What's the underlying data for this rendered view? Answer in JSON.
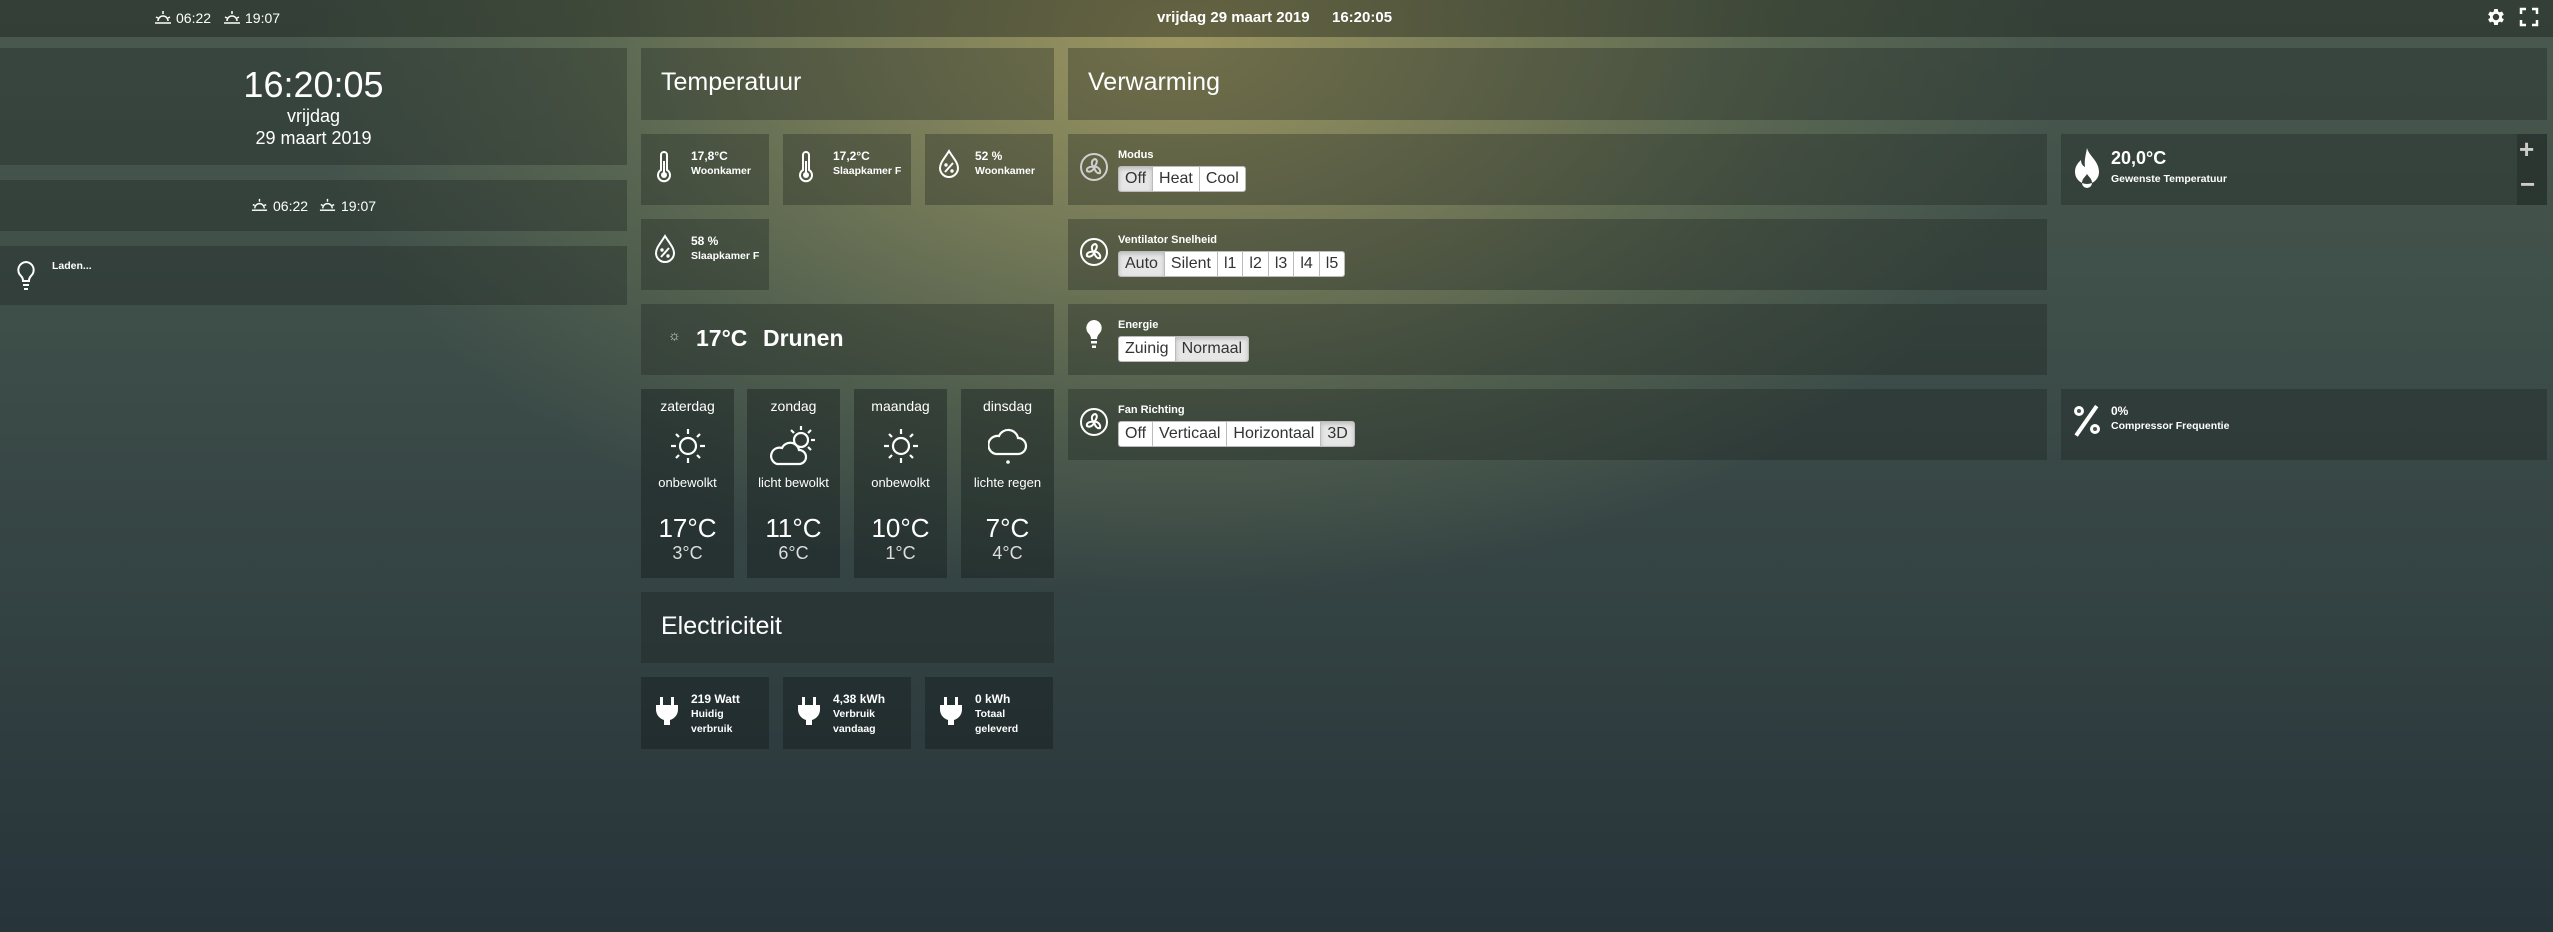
{
  "topbar": {
    "sunrise": "06:22",
    "sunset": "19:07",
    "date": "vrijdag 29 maart 2019",
    "time": "16:20:05"
  },
  "clock": {
    "time": "16:20:05",
    "weekday": "vrijdag",
    "date": "29 maart 2019"
  },
  "sun": {
    "sunrise": "06:22",
    "sunset": "19:07"
  },
  "loading": {
    "label": "Laden..."
  },
  "temperature": {
    "title": "Temperatuur",
    "tiles": [
      {
        "value": "17,8°C",
        "label": "Woonkamer"
      },
      {
        "value": "17,2°C",
        "label": "Slaapkamer F"
      },
      {
        "value": "52 %",
        "label": "Woonkamer"
      },
      {
        "value": "58 %",
        "label": "Slaapkamer F"
      }
    ]
  },
  "weather": {
    "current_temp": "17°C",
    "location": "Drunen",
    "forecast": [
      {
        "day": "zaterdag",
        "desc": "onbewolkt",
        "high": "17°C",
        "low": "3°C",
        "icon": "sun-icon"
      },
      {
        "day": "zondag",
        "desc": "licht bewolkt",
        "high": "11°C",
        "low": "6°C",
        "icon": "partly-cloudy-icon"
      },
      {
        "day": "maandag",
        "desc": "onbewolkt",
        "high": "10°C",
        "low": "1°C",
        "icon": "sun-icon"
      },
      {
        "day": "dinsdag",
        "desc": "lichte regen",
        "high": "7°C",
        "low": "4°C",
        "icon": "rain-icon"
      }
    ]
  },
  "electricity": {
    "title": "Electriciteit",
    "tiles": [
      {
        "value": "219 Watt",
        "label": "Huidig verbruik"
      },
      {
        "value": "4,38 kWh",
        "label": "Verbruik vandaag"
      },
      {
        "value": "0 kWh",
        "label": "Totaal geleverd"
      }
    ]
  },
  "heating": {
    "title": "Verwarming",
    "modus": {
      "label": "Modus",
      "options": [
        "Off",
        "Heat",
        "Cool"
      ],
      "active": "Off"
    },
    "fan_speed": {
      "label": "Ventilator Snelheid",
      "options": [
        "Auto",
        "Silent",
        "l1",
        "l2",
        "l3",
        "l4",
        "l5"
      ],
      "active": "Auto"
    },
    "energy": {
      "label": "Energie",
      "options": [
        "Zuinig",
        "Normaal"
      ],
      "active": "Normaal"
    },
    "fan_direction": {
      "label": "Fan Richting",
      "options": [
        "Off",
        "Verticaal",
        "Horizontaal",
        "3D"
      ],
      "active": "3D"
    },
    "setpoint": {
      "value": "20,0°C",
      "label": "Gewenste Temperatuur"
    },
    "compressor": {
      "value": "0%",
      "label": "Compressor Frequentie"
    }
  }
}
